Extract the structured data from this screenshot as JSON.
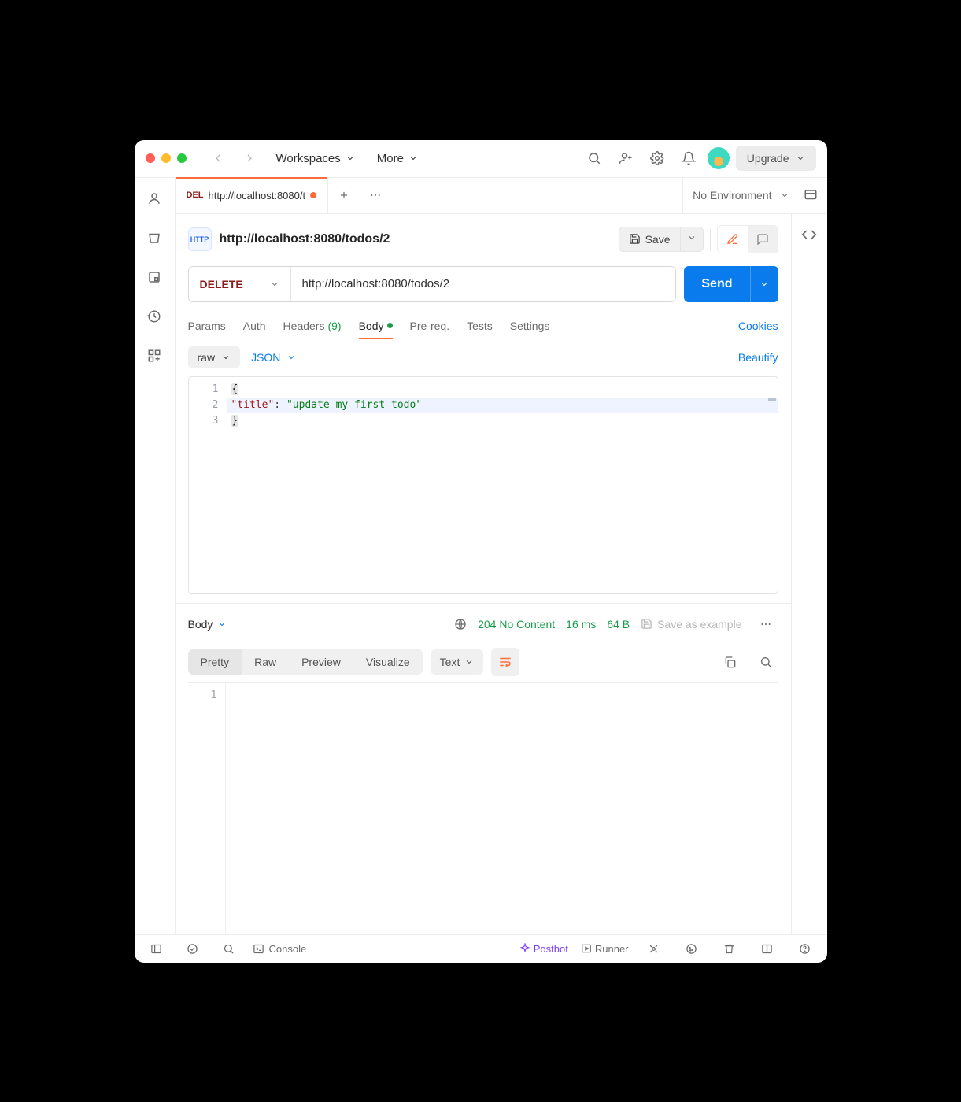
{
  "titlebar": {
    "workspaces_label": "Workspaces",
    "more_label": "More",
    "upgrade_label": "Upgrade"
  },
  "tabs": {
    "active": {
      "method": "DEL",
      "title": "http://localhost:8080/t",
      "unsaved": true
    }
  },
  "environment": {
    "label": "No Environment"
  },
  "request": {
    "protocol_chip": "HTTP",
    "title": "http://localhost:8080/todos/2",
    "save_label": "Save",
    "method": "DELETE",
    "url": "http://localhost:8080/todos/2",
    "send_label": "Send",
    "subtabs": {
      "params": "Params",
      "auth": "Auth",
      "headers": "Headers",
      "headers_count": "(9)",
      "body": "Body",
      "prereq": "Pre-req.",
      "tests": "Tests",
      "settings": "Settings",
      "cookies": "Cookies"
    },
    "body_type": {
      "raw": "raw",
      "format": "JSON",
      "beautify": "Beautify"
    },
    "body_lines": {
      "l1": "{",
      "l2_key": "\"title\"",
      "l2_sep": ": ",
      "l2_val": "\"update my first todo\"",
      "l3": "}"
    },
    "gutter": {
      "l1": "1",
      "l2": "2",
      "l3": "3"
    }
  },
  "response": {
    "section_label": "Body",
    "status_code": "204",
    "status_text": "No Content",
    "time": "16 ms",
    "size": "64 B",
    "save_example": "Save as example",
    "view_tabs": {
      "pretty": "Pretty",
      "raw": "Raw",
      "preview": "Preview",
      "visualize": "Visualize"
    },
    "text_label": "Text",
    "gutter": {
      "l1": "1"
    }
  },
  "statusbar": {
    "console": "Console",
    "postbot": "Postbot",
    "runner": "Runner"
  }
}
